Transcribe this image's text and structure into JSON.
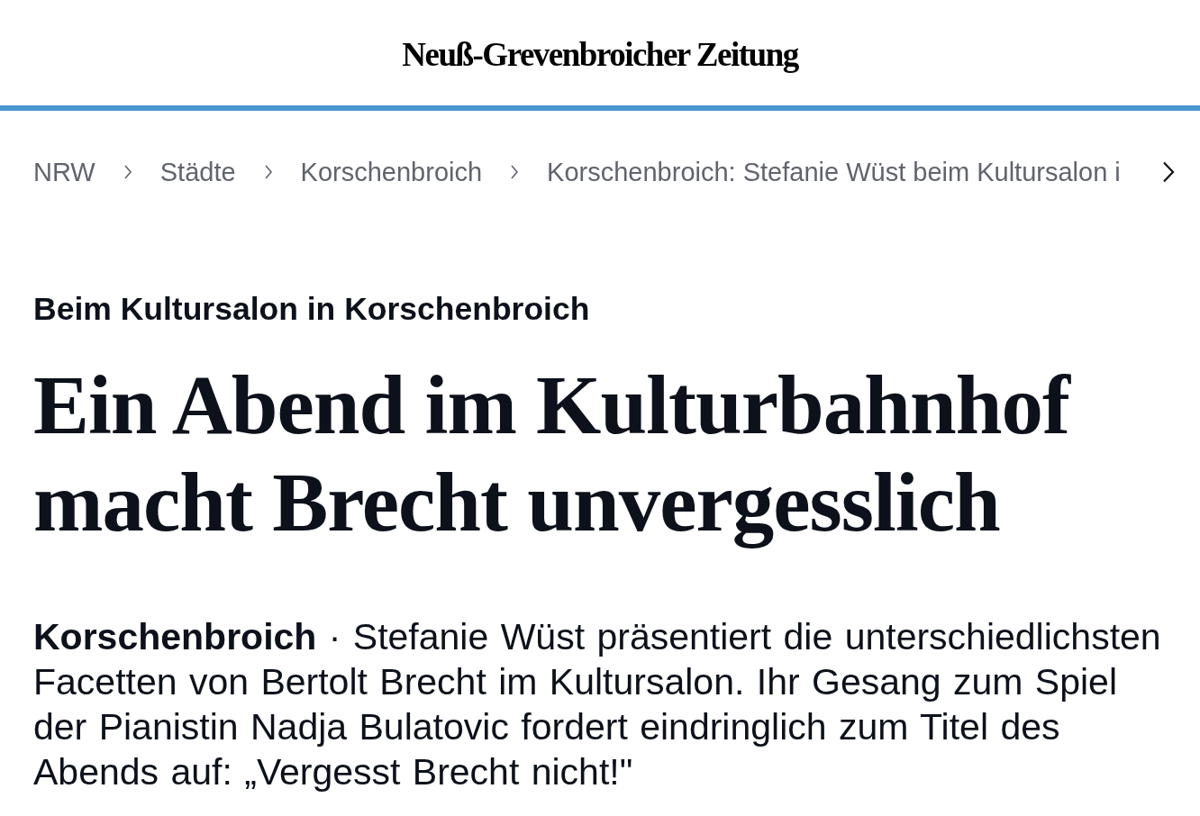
{
  "header": {
    "logo": "Neuß-Grevenbroicher Zeitung"
  },
  "breadcrumb": {
    "items": [
      {
        "label": "NRW"
      },
      {
        "label": "Städte"
      },
      {
        "label": "Korschenbroich"
      },
      {
        "label": "Korschenbroich: Stefanie Wüst beim Kultursalon i"
      }
    ]
  },
  "article": {
    "kicker": "Beim Kultursalon in Korschenbroich",
    "headline": "Ein Abend im Kulturbahnhof macht Brecht unvergesslich",
    "lead": "**Korschenbroich** · Stefanie Wüst präsentiert die unterschiedlichsten Facetten von Bertolt Brecht im Kultursalon. Ihr Gesang zum Spiel der Pianistin Nadja Bulatovic fordert eindringlich zum Titel des Abends auf: „Vergesst Brecht nicht!\""
  }
}
